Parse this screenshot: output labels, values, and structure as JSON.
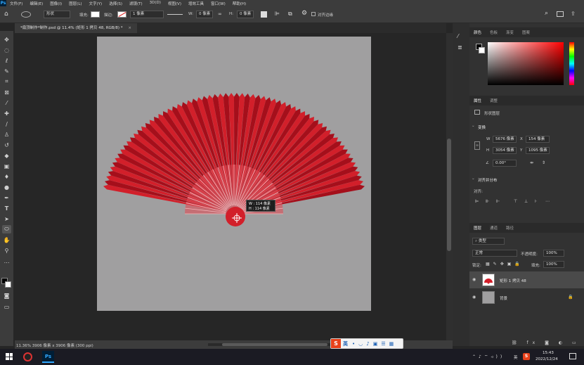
{
  "app": {
    "menus": [
      "文件(F)",
      "编辑(E)",
      "图像(I)",
      "图层(L)",
      "文字(Y)",
      "选择(S)",
      "滤镜(T)",
      "3D(D)",
      "视图(V)",
      "增效工具",
      "窗口(W)",
      "帮助(H)"
    ]
  },
  "options": {
    "shape_mode": "形状",
    "fill_label": "填充:",
    "stroke_label": "描边:",
    "stroke_width": "1 像素",
    "w_label": "W:",
    "w_value": "0 像素",
    "h_label": "H:",
    "h_value": "0 像素",
    "align_edges": "对齐边缘"
  },
  "document": {
    "tab_title": "*扇顶制作*制作.psd @ 11.4% (矩形 1 拷贝 48, RGB/8) *",
    "tooltip_w": "W : 114 像素",
    "tooltip_h": "H : 114 像素"
  },
  "status": {
    "text": "11.36%   3906 像素 x 3906 像素 (300 ppi)"
  },
  "panels": {
    "color_tabs": [
      "颜色",
      "色板",
      "渐变",
      "图案"
    ],
    "props_tabs": [
      "属性",
      "调整"
    ],
    "layer_type": "形状图层",
    "transform_title": "变换",
    "w_label": "W",
    "w_value": "5676 像素",
    "x_label": "X",
    "x_value": "154 像素",
    "h_label": "H",
    "h_value": "3054 像素",
    "y_label": "Y",
    "y_value": "1095 像素",
    "angle": "0.00°",
    "align_title": "对齐并分布",
    "align_label": "对齐:",
    "layers_tabs": [
      "图层",
      "通道",
      "路径"
    ],
    "filter_kind": "类型",
    "blend_mode": "正常",
    "opacity_label": "不透明度:",
    "opacity_value": "100%",
    "lock_label": "锁定:",
    "fill_label": "填充:",
    "fill_value": "100%",
    "layers": [
      {
        "name": "矩形 1 拷贝 48"
      },
      {
        "name": "背景"
      }
    ]
  },
  "taskbar": {
    "ime_label": "英",
    "lang": "英",
    "time": "15:43",
    "date": "2022/12/24"
  },
  "colors": {
    "fan_red": "#d21f2a",
    "fan_dark": "#a50f1b",
    "artboard": "#a09fa0"
  }
}
